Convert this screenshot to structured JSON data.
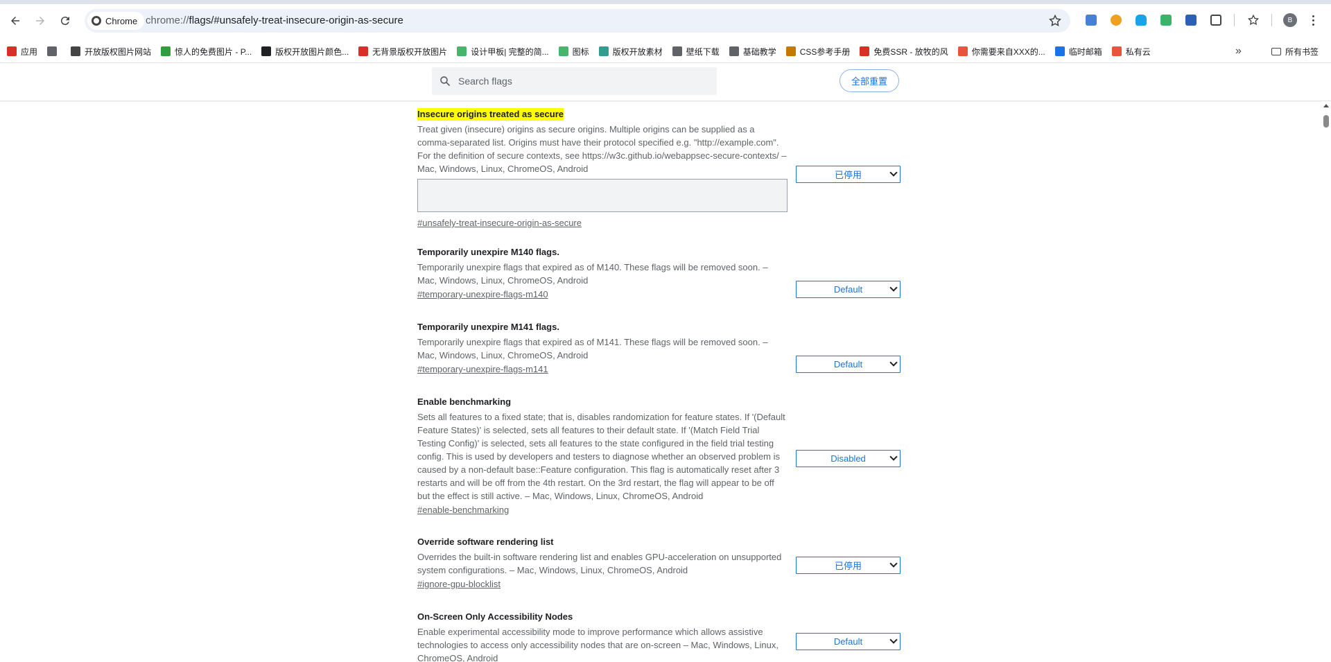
{
  "browser": {
    "chip_label": "Chrome",
    "url_host": "chrome://",
    "url_path": "flags/#unsafely-treat-insecure-origin-as-secure",
    "avatar_letter": "B"
  },
  "bookmarks": [
    {
      "label": "应用",
      "color": "#d93025"
    },
    {
      "label": "",
      "color": "#5f6368"
    },
    {
      "label": "开放版权图片网站",
      "color": "#444444"
    },
    {
      "label": "惊人的免费图片 - P...",
      "color": "#2e9e3f"
    },
    {
      "label": "版权开放图片颜色...",
      "color": "#202124"
    },
    {
      "label": "无背景版权开放图片",
      "color": "#d93025"
    },
    {
      "label": "设计甲板| 完整的简...",
      "color": "#48b66a"
    },
    {
      "label": "图标",
      "color": "#48b66a"
    },
    {
      "label": "版权开放素材",
      "color": "#2f9e8f"
    },
    {
      "label": "壁纸下载",
      "color": "#5f6368"
    },
    {
      "label": "基础教学",
      "color": "#5f6368"
    },
    {
      "label": "CSS参考手册",
      "color": "#c47a00"
    },
    {
      "label": "免费SSR - 放牧的风",
      "color": "#d93025"
    },
    {
      "label": "你需要来自XXX的...",
      "color": "#e8553a"
    },
    {
      "label": "临时邮箱",
      "color": "#1a73e8"
    },
    {
      "label": "私有云",
      "color": "#e8553a"
    }
  ],
  "bookmarks_more": "»",
  "bookmarks_all": "所有书签",
  "flags_header": {
    "search_placeholder": "Search flags",
    "reset_label": "全部重置"
  },
  "flags": [
    {
      "title": "Insecure origins treated as secure",
      "highlight": true,
      "description": "Treat given (insecure) origins as secure origins. Multiple origins can be supplied as a comma-separated list. Origins must have their protocol specified e.g. \"http://example.com\". For the definition of secure contexts, see https://w3c.github.io/webappsec-secure-contexts/ – Mac, Windows, Linux, ChromeOS, Android",
      "has_textarea": true,
      "textarea_value": "",
      "link": "#unsafely-treat-insecure-origin-as-secure",
      "select_value": "已停用"
    },
    {
      "title": "Temporarily unexpire M140 flags.",
      "description": "Temporarily unexpire flags that expired as of M140. These flags will be removed soon. – Mac, Windows, Linux, ChromeOS, Android",
      "link": "#temporary-unexpire-flags-m140",
      "select_value": "Default"
    },
    {
      "title": "Temporarily unexpire M141 flags.",
      "description": "Temporarily unexpire flags that expired as of M141. These flags will be removed soon. – Mac, Windows, Linux, ChromeOS, Android",
      "link": "#temporary-unexpire-flags-m141",
      "select_value": "Default"
    },
    {
      "title": "Enable benchmarking",
      "description": "Sets all features to a fixed state; that is, disables randomization for feature states. If '(Default Feature States)' is selected, sets all features to their default state. If '(Match Field Trial Testing Config)' is selected, sets all features to the state configured in the field trial testing config. This is used by developers and testers to diagnose whether an observed problem is caused by a non-default base::Feature configuration. This flag is automatically reset after 3 restarts and will be off from the 4th restart. On the 3rd restart, the flag will appear to be off but the effect is still active. – Mac, Windows, Linux, ChromeOS, Android",
      "link": "#enable-benchmarking",
      "select_value": "Disabled"
    },
    {
      "title": "Override software rendering list",
      "description": "Overrides the built-in software rendering list and enables GPU-acceleration on unsupported system configurations. – Mac, Windows, Linux, ChromeOS, Android",
      "link": "#ignore-gpu-blocklist",
      "select_value": "已停用"
    },
    {
      "title": "On-Screen Only Accessibility Nodes",
      "description": "Enable experimental accessibility mode to improve performance which allows assistive technologies to access only accessibility nodes that are on-screen – Mac, Windows, Linux, ChromeOS, Android",
      "link": "",
      "select_value": "Default"
    }
  ],
  "icons": {
    "back": "arrow-left-icon",
    "forward": "arrow-right-icon",
    "reload": "reload-icon",
    "bookmark_star": "star-icon",
    "search": "search-icon",
    "menu": "kebab-menu-icon"
  },
  "colors": {
    "accent": "#1a73e8",
    "highlight": "#ffff00"
  }
}
